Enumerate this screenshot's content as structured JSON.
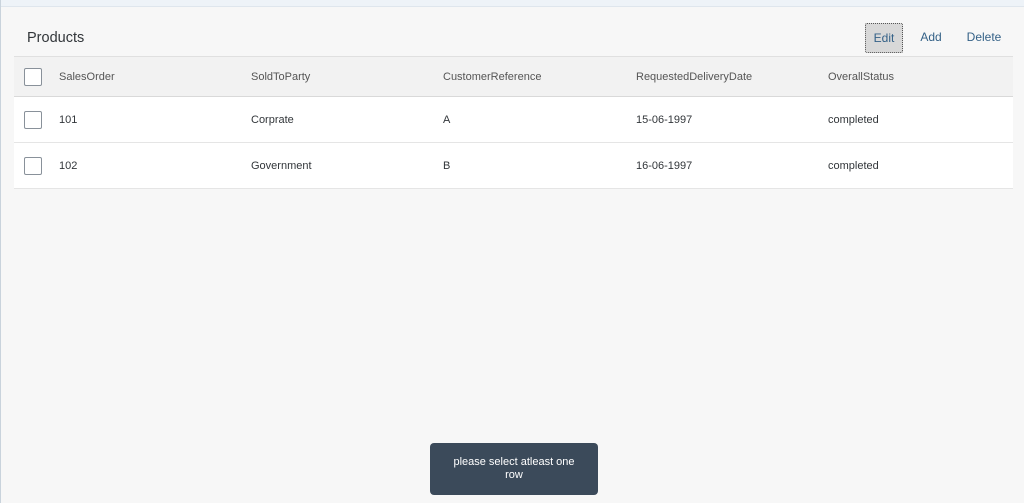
{
  "toolbar": {
    "title": "Products",
    "edit_label": "Edit",
    "add_label": "Add",
    "delete_label": "Delete"
  },
  "table": {
    "columns": [
      "SalesOrder",
      "SoldToParty",
      "CustomerReference",
      "RequestedDeliveryDate",
      "OverallStatus"
    ],
    "rows": [
      [
        "101",
        "Corprate",
        "A",
        "15-06-1997",
        "completed"
      ],
      [
        "102",
        "Government",
        "B",
        "16-06-1997",
        "completed"
      ]
    ]
  },
  "toast": {
    "message": "please select atleast one row"
  },
  "colors": {
    "background": "#f7f7f7",
    "link": "#346187",
    "toast": "#3b4a5a"
  }
}
